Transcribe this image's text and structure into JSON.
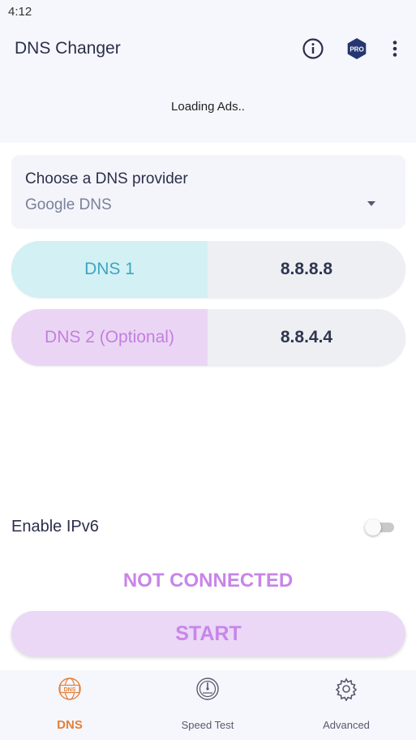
{
  "status_bar": {
    "time": "4:12"
  },
  "app_bar": {
    "title": "DNS Changer",
    "icons": {
      "info": "info-icon",
      "pro": "pro-badge-icon",
      "more": "more-vert-icon"
    },
    "pro_label": "PRO"
  },
  "ad": {
    "text": "Loading Ads.."
  },
  "provider": {
    "label": "Choose a DNS provider",
    "selected": "Google DNS"
  },
  "dns1": {
    "label": "DNS 1",
    "value": "8.8.8.8"
  },
  "dns2": {
    "label": "DNS 2 (Optional)",
    "value": "8.8.4.4"
  },
  "ipv6": {
    "label": "Enable IPv6",
    "enabled": false
  },
  "connection": {
    "status": "NOT CONNECTED"
  },
  "start": {
    "label": "START"
  },
  "bottom_nav": [
    {
      "label": "DNS",
      "icon": "globe-dns-icon",
      "active": true,
      "accent": "#e2803a"
    },
    {
      "label": "Speed Test",
      "icon": "speedometer-icon",
      "active": false
    },
    {
      "label": "Advanced",
      "icon": "gear-icon",
      "active": false
    }
  ],
  "colors": {
    "dns1_accent": "#3ea6c0",
    "dns2_accent": "#c47ee0",
    "status_purple": "#c885e8"
  }
}
